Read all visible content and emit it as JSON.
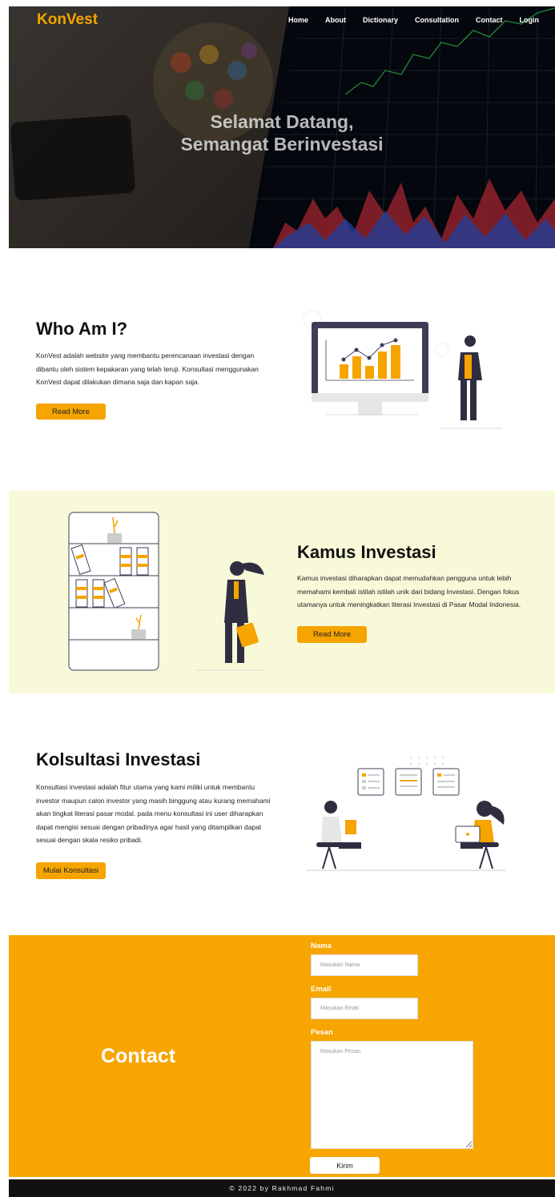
{
  "brand": "KonVest",
  "nav": [
    "Home",
    "About",
    "Dictionary",
    "Consultation",
    "Contact",
    "Login"
  ],
  "hero": {
    "line1": "Selamat Datang,",
    "line2": "Semangat Berinvestasi"
  },
  "who": {
    "title": "Who Am I?",
    "text": "KonVest adalah website yang membantu perencanaan investasi dengan dibantu oleh sistem kepakaran yang telah teruji. Konsultasi menggunakan KonVest dapat dilakukan dimana saja dan kapan saja.",
    "button": "Read More"
  },
  "kamus": {
    "title": "Kamus Investasi",
    "text": "Kamus investasi diharapkan dapat memudahkan pengguna untuk lebih memahami kembali istilah istilah unik dari bidang Investasi. Dengan fokus utamanya untuk meningkatkan literasi Investasi di Pasar Modal Indonesia.",
    "button": "Read More"
  },
  "konsultasi": {
    "title": "Kolsultasi Investasi",
    "text": "Konsultasi investasi adalah fitur utama yang kami miliki untuk membantu investor maupun calon investor yang masih binggung atau kurang memahami akan tingkat literasi pasar modal. pada menu konsultasi ini user diharapkan dapat mengisi sesuai dengan pribadinya agar hasil yang ditampilkan dapat sesuai dengan skala resiko pribadi.",
    "button": "Mulai Konsultasi"
  },
  "contact": {
    "title": "Contact",
    "name_label": "Nama",
    "name_placeholder": "Masukan Nama",
    "email_label": "Email",
    "email_placeholder": "Masukan Email",
    "message_label": "Pesan",
    "message_placeholder": "Masukan Pesan",
    "send": "Kirim"
  },
  "footer": "© 2022 by Rakhmad Fahmi",
  "colors": {
    "accent": "#f5a400",
    "kamus_bg": "#f8f9d8",
    "footer_bg": "#111111"
  }
}
